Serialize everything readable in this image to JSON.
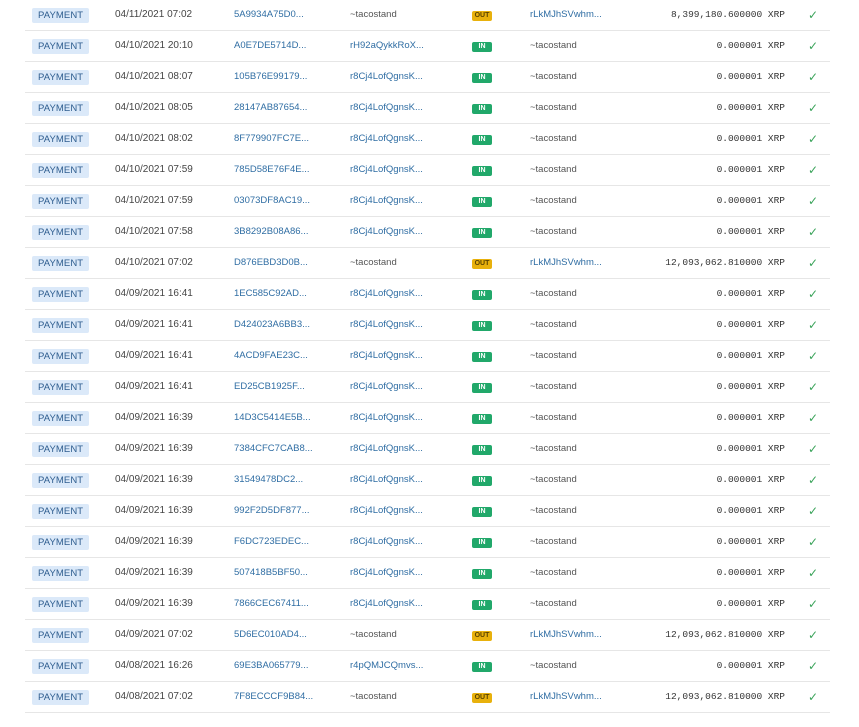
{
  "rows": [
    {
      "type": "PAYMENT",
      "date": "04/11/2021 07:02",
      "hash": "5A9934A75D0...",
      "from": "~tacostand",
      "dir": "OUT",
      "to": "rLkMJhSVwhm...",
      "amount": "8,399,180.600000 XRP"
    },
    {
      "type": "PAYMENT",
      "date": "04/10/2021 20:10",
      "hash": "A0E7DE5714D...",
      "from": "rH92aQykkRoX...",
      "dir": "IN",
      "to": "~tacostand",
      "amount": "0.000001 XRP"
    },
    {
      "type": "PAYMENT",
      "date": "04/10/2021 08:07",
      "hash": "105B76E99179...",
      "from": "r8Cj4LofQgnsK...",
      "dir": "IN",
      "to": "~tacostand",
      "amount": "0.000001 XRP"
    },
    {
      "type": "PAYMENT",
      "date": "04/10/2021 08:05",
      "hash": "28147AB87654...",
      "from": "r8Cj4LofQgnsK...",
      "dir": "IN",
      "to": "~tacostand",
      "amount": "0.000001 XRP"
    },
    {
      "type": "PAYMENT",
      "date": "04/10/2021 08:02",
      "hash": "8F779907FC7E...",
      "from": "r8Cj4LofQgnsK...",
      "dir": "IN",
      "to": "~tacostand",
      "amount": "0.000001 XRP"
    },
    {
      "type": "PAYMENT",
      "date": "04/10/2021 07:59",
      "hash": "785D58E76F4E...",
      "from": "r8Cj4LofQgnsK...",
      "dir": "IN",
      "to": "~tacostand",
      "amount": "0.000001 XRP"
    },
    {
      "type": "PAYMENT",
      "date": "04/10/2021 07:59",
      "hash": "03073DF8AC19...",
      "from": "r8Cj4LofQgnsK...",
      "dir": "IN",
      "to": "~tacostand",
      "amount": "0.000001 XRP"
    },
    {
      "type": "PAYMENT",
      "date": "04/10/2021 07:58",
      "hash": "3B8292B08A86...",
      "from": "r8Cj4LofQgnsK...",
      "dir": "IN",
      "to": "~tacostand",
      "amount": "0.000001 XRP"
    },
    {
      "type": "PAYMENT",
      "date": "04/10/2021 07:02",
      "hash": "D876EBD3D0B...",
      "from": "~tacostand",
      "dir": "OUT",
      "to": "rLkMJhSVwhm...",
      "amount": "12,093,062.810000 XRP"
    },
    {
      "type": "PAYMENT",
      "date": "04/09/2021 16:41",
      "hash": "1EC585C92AD...",
      "from": "r8Cj4LofQgnsK...",
      "dir": "IN",
      "to": "~tacostand",
      "amount": "0.000001 XRP"
    },
    {
      "type": "PAYMENT",
      "date": "04/09/2021 16:41",
      "hash": "D424023A6BB3...",
      "from": "r8Cj4LofQgnsK...",
      "dir": "IN",
      "to": "~tacostand",
      "amount": "0.000001 XRP"
    },
    {
      "type": "PAYMENT",
      "date": "04/09/2021 16:41",
      "hash": "4ACD9FAE23C...",
      "from": "r8Cj4LofQgnsK...",
      "dir": "IN",
      "to": "~tacostand",
      "amount": "0.000001 XRP"
    },
    {
      "type": "PAYMENT",
      "date": "04/09/2021 16:41",
      "hash": "ED25CB1925F...",
      "from": "r8Cj4LofQgnsK...",
      "dir": "IN",
      "to": "~tacostand",
      "amount": "0.000001 XRP"
    },
    {
      "type": "PAYMENT",
      "date": "04/09/2021 16:39",
      "hash": "14D3C5414E5B...",
      "from": "r8Cj4LofQgnsK...",
      "dir": "IN",
      "to": "~tacostand",
      "amount": "0.000001 XRP"
    },
    {
      "type": "PAYMENT",
      "date": "04/09/2021 16:39",
      "hash": "7384CFC7CAB8...",
      "from": "r8Cj4LofQgnsK...",
      "dir": "IN",
      "to": "~tacostand",
      "amount": "0.000001 XRP"
    },
    {
      "type": "PAYMENT",
      "date": "04/09/2021 16:39",
      "hash": "31549478DC2...",
      "from": "r8Cj4LofQgnsK...",
      "dir": "IN",
      "to": "~tacostand",
      "amount": "0.000001 XRP"
    },
    {
      "type": "PAYMENT",
      "date": "04/09/2021 16:39",
      "hash": "992F2D5DF877...",
      "from": "r8Cj4LofQgnsK...",
      "dir": "IN",
      "to": "~tacostand",
      "amount": "0.000001 XRP"
    },
    {
      "type": "PAYMENT",
      "date": "04/09/2021 16:39",
      "hash": "F6DC723EDEC...",
      "from": "r8Cj4LofQgnsK...",
      "dir": "IN",
      "to": "~tacostand",
      "amount": "0.000001 XRP"
    },
    {
      "type": "PAYMENT",
      "date": "04/09/2021 16:39",
      "hash": "507418B5BF50...",
      "from": "r8Cj4LofQgnsK...",
      "dir": "IN",
      "to": "~tacostand",
      "amount": "0.000001 XRP"
    },
    {
      "type": "PAYMENT",
      "date": "04/09/2021 16:39",
      "hash": "7866CEC67411...",
      "from": "r8Cj4LofQgnsK...",
      "dir": "IN",
      "to": "~tacostand",
      "amount": "0.000001 XRP"
    },
    {
      "type": "PAYMENT",
      "date": "04/09/2021 07:02",
      "hash": "5D6EC010AD4...",
      "from": "~tacostand",
      "dir": "OUT",
      "to": "rLkMJhSVwhm...",
      "amount": "12,093,062.810000 XRP"
    },
    {
      "type": "PAYMENT",
      "date": "04/08/2021 16:26",
      "hash": "69E3BA065779...",
      "from": "r4pQMJCQmvs...",
      "dir": "IN",
      "to": "~tacostand",
      "amount": "0.000001 XRP"
    },
    {
      "type": "PAYMENT",
      "date": "04/08/2021 07:02",
      "hash": "7F8ECCCF9B84...",
      "from": "~tacostand",
      "dir": "OUT",
      "to": "rLkMJhSVwhm...",
      "amount": "12,093,062.810000 XRP"
    }
  ],
  "colors": {
    "in_badge": "#21a86a",
    "out_badge": "#e8b10c",
    "type_badge_bg": "#dbe9f9",
    "link": "#2f6da3",
    "check": "#3aa35a"
  },
  "icons": {
    "status": "check-icon"
  }
}
